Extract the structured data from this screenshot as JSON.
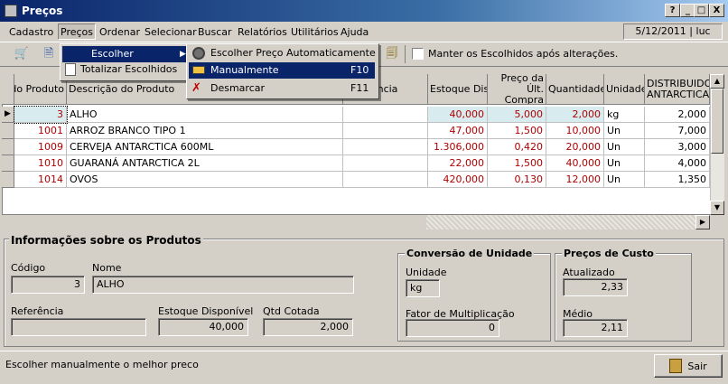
{
  "window": {
    "title": "Preços",
    "btn_help": "?",
    "btn_min": "_",
    "btn_max": "□",
    "btn_close": "X"
  },
  "menubar": {
    "items": [
      "Cadastro",
      "Preços",
      "Ordenar",
      "Selecionar",
      "Buscar",
      "Relatórios",
      "Utilitários",
      "Ajuda"
    ],
    "date_user": "5/12/2011 | luc"
  },
  "toolbar": {
    "keep_selected_label": "Manter os Escolhidos após alterações."
  },
  "precos_menu": {
    "items": [
      "Escolher",
      "Totalizar Escolhidos"
    ]
  },
  "escolher_submenu": {
    "items": [
      {
        "label": "Escolher Preço Automaticamente",
        "shortcut": ""
      },
      {
        "label": "Manualmente",
        "shortcut": "F10"
      },
      {
        "label": "Desmarcar",
        "shortcut": "F11"
      }
    ]
  },
  "grid": {
    "headers": {
      "codigo": "Cód. do Produto",
      "descricao": "Descrição do Produto",
      "referencia": "Referência",
      "estoque": "Estoque Disp",
      "preco": "Preço da Últ. Compra",
      "quantidade": "Quantidade",
      "unidade": "Unidade",
      "distribuidor": "DISTRIBUIDO ANTARCTICA"
    },
    "rows": [
      {
        "codigo": "3",
        "descricao": "ALHO",
        "referencia": "",
        "estoque": "40,000",
        "preco": "5,000",
        "quantidade": "2,000",
        "unidade": "kg",
        "distribuidor": "2,000"
      },
      {
        "codigo": "1001",
        "descricao": "ARROZ BRANCO TIPO 1",
        "referencia": "",
        "estoque": "47,000",
        "preco": "1,500",
        "quantidade": "10,000",
        "unidade": "Un",
        "distribuidor": "7,000"
      },
      {
        "codigo": "1009",
        "descricao": "CERVEJA ANTARCTICA 600ML",
        "referencia": "",
        "estoque": "1.306,000",
        "preco": "0,420",
        "quantidade": "20,000",
        "unidade": "Un",
        "distribuidor": "3,000"
      },
      {
        "codigo": "1010",
        "descricao": "GUARANÁ ANTARCTICA 2L",
        "referencia": "",
        "estoque": "22,000",
        "preco": "1,500",
        "quantidade": "40,000",
        "unidade": "Un",
        "distribuidor": "4,000"
      },
      {
        "codigo": "1014",
        "descricao": "OVOS",
        "referencia": "",
        "estoque": "420,000",
        "preco": "0,130",
        "quantidade": "12,000",
        "unidade": "Un",
        "distribuidor": "1,350"
      }
    ]
  },
  "info": {
    "title": "Informações sobre os Produtos",
    "codigo_label": "Código",
    "codigo_value": "3",
    "nome_label": "Nome",
    "nome_value": "ALHO",
    "referencia_label": "Referência",
    "referencia_value": "",
    "estoque_label": "Estoque Disponível",
    "estoque_value": "40,000",
    "qtd_label": "Qtd Cotada",
    "qtd_value": "2,000"
  },
  "conversao": {
    "title": "Conversão de Unidade",
    "unidade_label": "Unidade",
    "unidade_value": "kg",
    "fator_label": "Fator de Multiplicação",
    "fator_value": "0"
  },
  "custo": {
    "title": "Preços de Custo",
    "atualizado_label": "Atualizado",
    "atualizado_value": "2,33",
    "medio_label": "Médio",
    "medio_value": "2,11"
  },
  "status": {
    "message": "Escolher manualmente o melhor preco",
    "sair_label": "Sair"
  }
}
